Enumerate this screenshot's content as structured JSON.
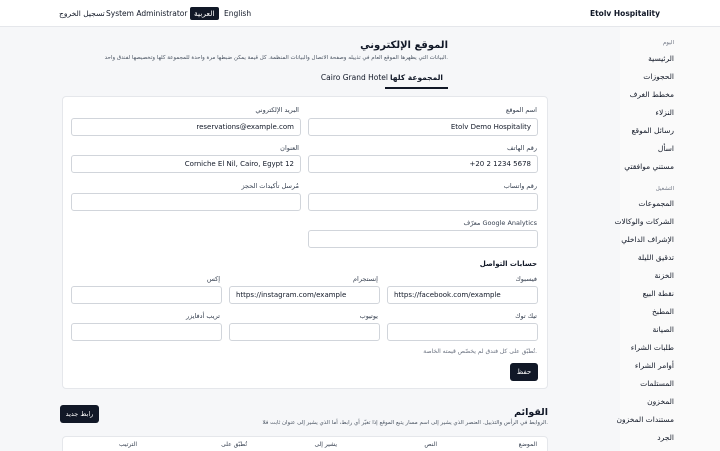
{
  "topbar": {
    "brand": "Etolv Hospitality",
    "lang_en": "English",
    "lang_ar": "العربية",
    "user": "System Administrator",
    "logout": "تسجيل الخروج"
  },
  "sidebar": {
    "section_today": "اليوم",
    "items_today": [
      "الرئيسية",
      "الحجوزات",
      "مخطط الغرف",
      "النزلاء",
      "رسائل الموقع",
      "اسأل",
      "مستني موافقتي"
    ],
    "section_ops": "التشغيل",
    "items_ops": [
      "المجموعات",
      "الشركات والوكالات",
      "الإشراف الداخلي",
      "تدقيق الليلة",
      "الخزنة",
      "نقطة البيع",
      "المطبخ",
      "الصيانة",
      "طلبات الشراء",
      "أوامر الشراء",
      "المستلمات",
      "المخزون",
      "مستندات المخزون",
      "الجرد"
    ]
  },
  "page": {
    "title": "الموقع الإلكتروني",
    "description": "البيانات التي يظهرها الموقع العام في تذييله وصفحة الاتصال والبيانات المنظمة. كل قيمة يمكن ضبطها مرة واحدة للمجموعة كلها وتخصيصها لفندق واحد.",
    "tabs": [
      "المجموعة كلها",
      "Cairo Grand Hotel"
    ]
  },
  "form": {
    "site_name_label": "اسم الموقع",
    "site_name_value": "Etolv Demo Hospitality",
    "email_label": "البريد الإلكتروني",
    "email_value": "reservations@example.com",
    "phone_label": "رقم الهاتف",
    "phone_value": "+20 2 1234 5678",
    "address_label": "العنوان",
    "address_value": "Corniche El Nil, Cairo, Egypt 12",
    "whatsapp_label": "رقم واتساب",
    "whatsapp_value": "",
    "booking_sender_label": "مُرسل تأكيدات الحجز",
    "booking_sender_value": "",
    "ga_label": "معرّف Google Analytics",
    "ga_value": "",
    "social_heading": "حسابات التواصل",
    "facebook_label": "فيسبوك",
    "facebook_value": "https://facebook.com/example",
    "instagram_label": "إنستجرام",
    "instagram_value": "https://instagram.com/example",
    "x_label": "إكس",
    "x_value": "",
    "tiktok_label": "تيك توك",
    "tiktok_value": "",
    "youtube_label": "يوتيوب",
    "youtube_value": "",
    "tripadvisor_label": "تريب أدفايزر",
    "tripadvisor_value": "",
    "note": "تُطبّق على كل فندق لم يخصّص قيمته الخاصة.",
    "save_label": "حفظ"
  },
  "menus": {
    "title": "القوائم",
    "description": "الروابط في الرأس والتذييل. العنصر الذي يشير إلى اسم مسار يتبع الموقع إذا تغيّر أي رابط، أما الذي يشير إلى عنوان ثابت فلا.",
    "new_link_label": "رابط جديد",
    "columns": [
      "الموضع",
      "النص",
      "يشير إلى",
      "تُطبّق على",
      "الترتيب"
    ]
  }
}
